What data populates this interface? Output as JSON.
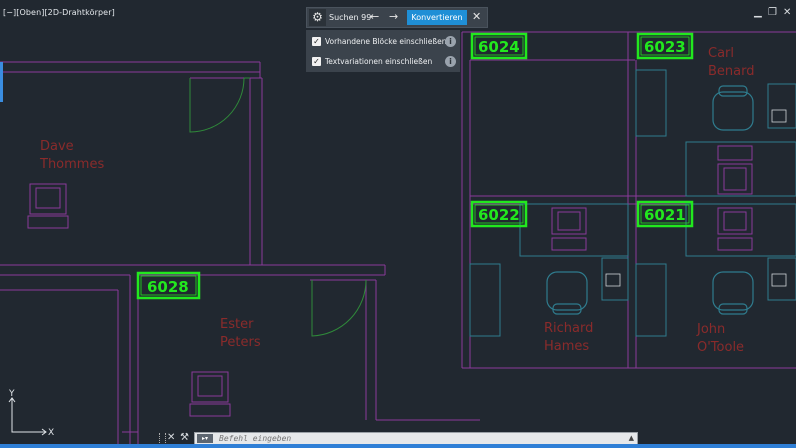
{
  "viewport": {
    "label": "[−][Oben][2D-Drahtkörper]",
    "window_controls": [
      "▁",
      "❐",
      "✕"
    ]
  },
  "toolbar": {
    "gear_icon": "gear-icon",
    "search_label": "Suchen 99",
    "prev_arrow": "←",
    "next_arrow": "→",
    "convert_label": "Konvertieren",
    "close": "✕"
  },
  "options": [
    {
      "label": "Vorhandene Blöcke einschließen",
      "checked": true
    },
    {
      "label": "Textvariationen einschließen",
      "checked": true
    }
  ],
  "room_tags": [
    "6024",
    "6023",
    "6022",
    "6021",
    "6028"
  ],
  "room_names": {
    "dave": [
      "Dave",
      "Thommes"
    ],
    "carl": [
      "Carl",
      "Benard"
    ],
    "ester": [
      "Ester",
      "Peters"
    ],
    "richard": [
      "Richard",
      "Hames"
    ],
    "john": [
      "John",
      "O'Toole"
    ]
  },
  "ucs": {
    "y": "Y",
    "x": "X"
  },
  "command_line": {
    "placeholder": "Befehl eingeben",
    "prompt_icon": "command-prompt-icon",
    "close": "✕",
    "wrench": "⚒"
  },
  "colors": {
    "background": "#212830",
    "wall": "#8a3a9a",
    "tag": "#22e81e",
    "name_text": "#8a2b2b",
    "furniture": "#2f7c8e",
    "door_arc": "#2f8a3a",
    "convert_button": "#1f8fd6"
  }
}
